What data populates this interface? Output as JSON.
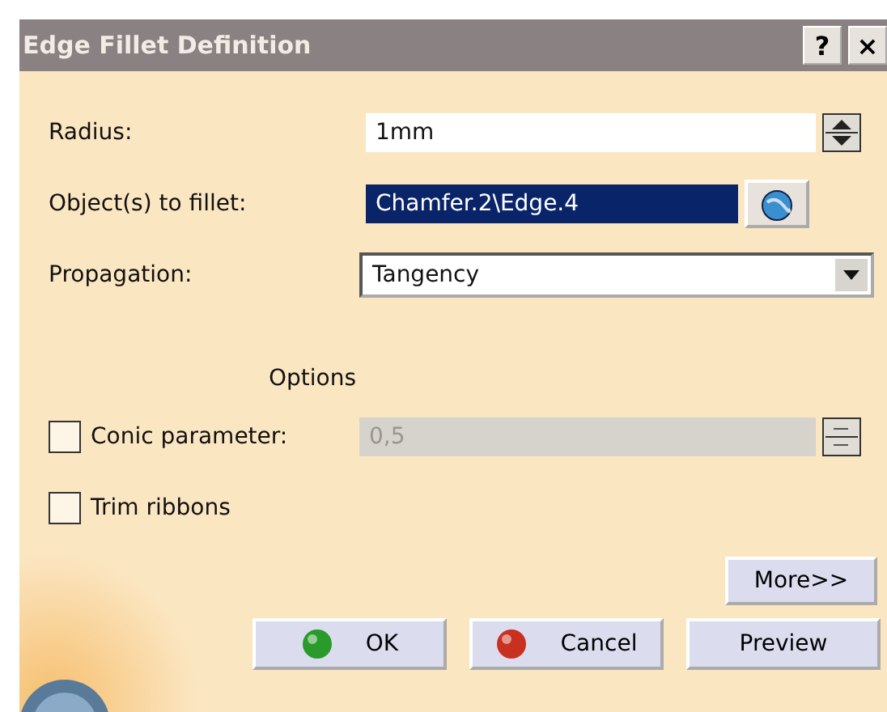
{
  "window": {
    "title": "Edge Fillet Definition",
    "help": "?",
    "close": "×"
  },
  "radius": {
    "label": "Radius:",
    "value": "1mm"
  },
  "objects": {
    "label": "Object(s) to fillet:",
    "value": "Chamfer.2\\Edge.4",
    "selected": true
  },
  "propagation": {
    "label": "Propagation:",
    "value": "Tangency"
  },
  "options": {
    "title": "Options",
    "items": [
      {
        "kind": "spin",
        "label": "Conic parameter:",
        "checked": false,
        "value": "0,5",
        "disabled": true
      },
      {
        "kind": "check",
        "label": "Trim ribbons",
        "checked": false
      }
    ]
  },
  "more_button": "More>>",
  "buttons": [
    {
      "kind": "ok",
      "label": "OK"
    },
    {
      "kind": "cancel",
      "label": "Cancel"
    },
    {
      "kind": "plain",
      "label": "Preview"
    }
  ]
}
